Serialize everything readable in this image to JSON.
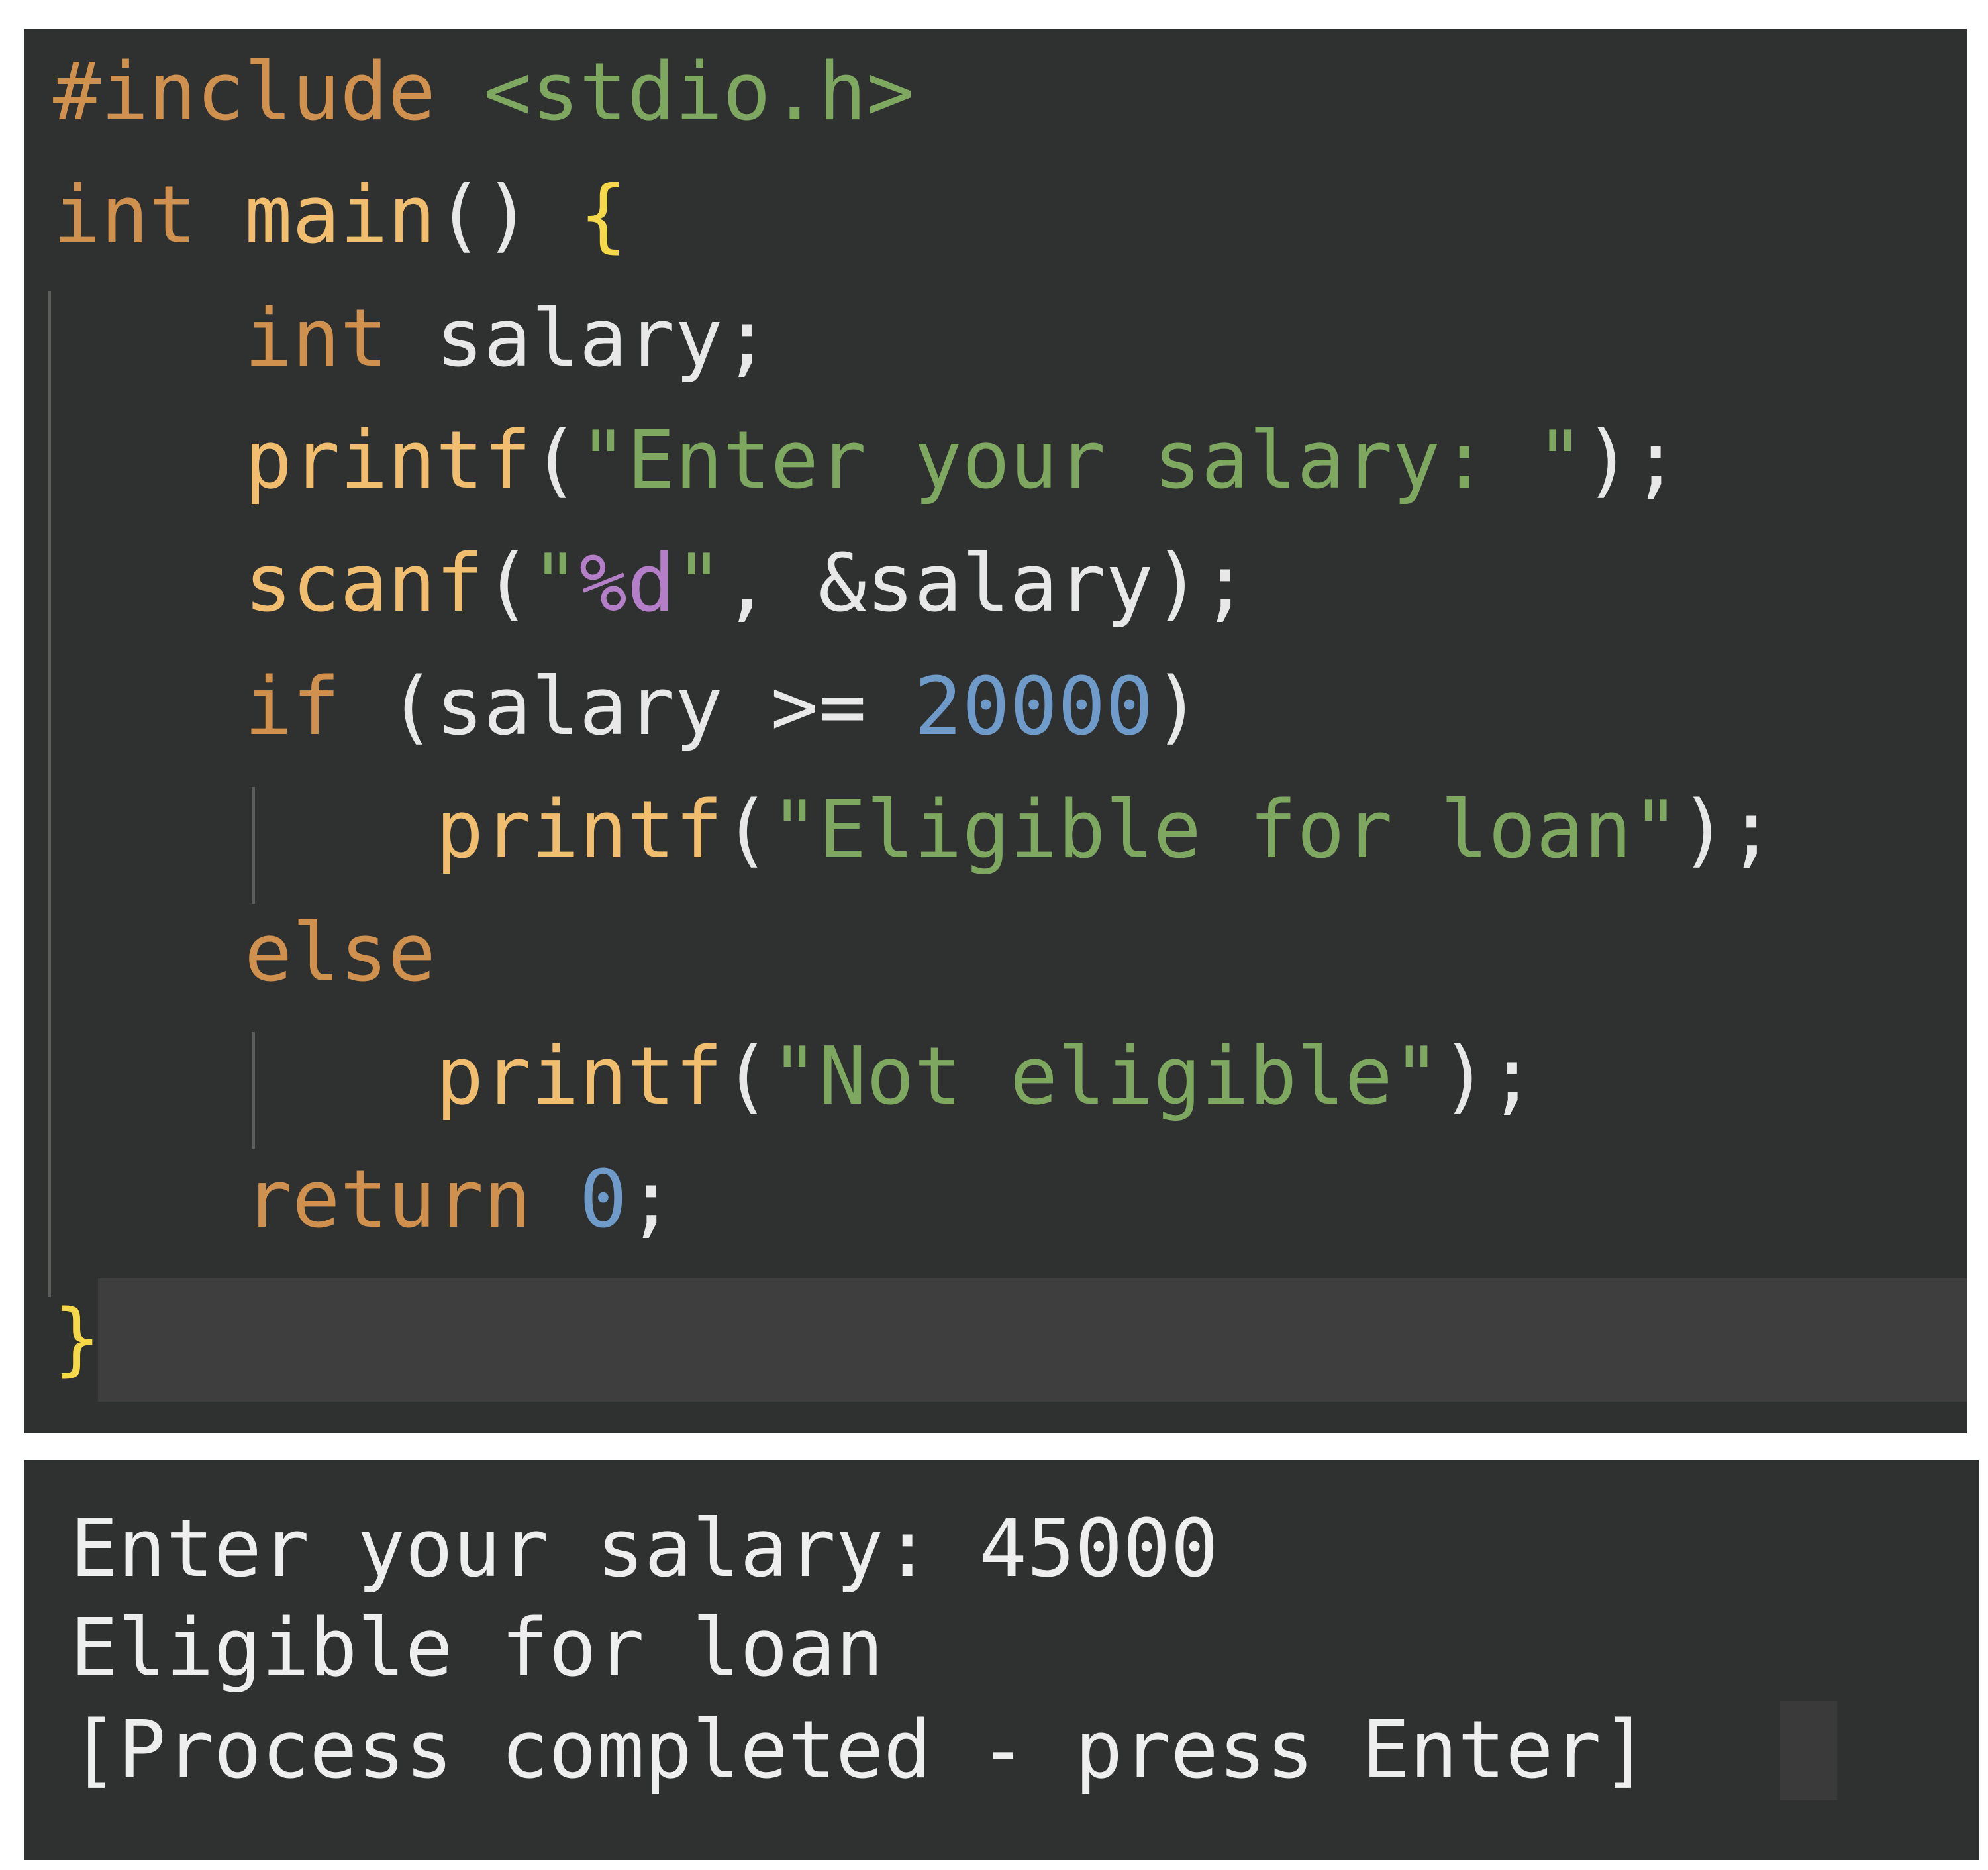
{
  "colors": {
    "keyword": "#d0914e",
    "function": "#f0be6e",
    "string": "#7ea860",
    "format_specifier": "#b57ec9",
    "number": "#6f9bcb",
    "brace": "#f5d94a",
    "plain": "#e8e8e8",
    "background": "#2f3130",
    "cursor_line": "#3e3e3e"
  },
  "editor": {
    "lines": [
      [
        {
          "t": "#include ",
          "c": "keyword"
        },
        {
          "t": "<stdio.h>",
          "c": "string"
        }
      ],
      [
        {
          "t": "int",
          "c": "keyword"
        },
        {
          "t": " ",
          "c": "plain"
        },
        {
          "t": "main",
          "c": "function"
        },
        {
          "t": "() ",
          "c": "plain"
        },
        {
          "t": "{",
          "c": "brace"
        }
      ],
      [
        {
          "t": "    ",
          "c": "plain"
        },
        {
          "t": "int",
          "c": "keyword"
        },
        {
          "t": " salary;",
          "c": "plain"
        }
      ],
      [
        {
          "t": "    ",
          "c": "plain"
        },
        {
          "t": "printf",
          "c": "function"
        },
        {
          "t": "(",
          "c": "plain"
        },
        {
          "t": "\"Enter your salary: \"",
          "c": "string"
        },
        {
          "t": ");",
          "c": "plain"
        }
      ],
      [
        {
          "t": "    ",
          "c": "plain"
        },
        {
          "t": "scanf",
          "c": "function"
        },
        {
          "t": "(",
          "c": "plain"
        },
        {
          "t": "\"",
          "c": "string"
        },
        {
          "t": "%d",
          "c": "format_specifier"
        },
        {
          "t": "\"",
          "c": "string"
        },
        {
          "t": ", &salary);",
          "c": "plain"
        }
      ],
      [
        {
          "t": "    ",
          "c": "plain"
        },
        {
          "t": "if",
          "c": "keyword"
        },
        {
          "t": " (salary >= ",
          "c": "plain"
        },
        {
          "t": "20000",
          "c": "number"
        },
        {
          "t": ")",
          "c": "plain"
        }
      ],
      [
        {
          "t": "        ",
          "c": "plain"
        },
        {
          "t": "printf",
          "c": "function"
        },
        {
          "t": "(",
          "c": "plain"
        },
        {
          "t": "\"Eligible for loan\"",
          "c": "string"
        },
        {
          "t": ");",
          "c": "plain"
        }
      ],
      [
        {
          "t": "    ",
          "c": "plain"
        },
        {
          "t": "else",
          "c": "keyword"
        }
      ],
      [
        {
          "t": "        ",
          "c": "plain"
        },
        {
          "t": "printf",
          "c": "function"
        },
        {
          "t": "(",
          "c": "plain"
        },
        {
          "t": "\"Not eligible\"",
          "c": "string"
        },
        {
          "t": ");",
          "c": "plain"
        }
      ],
      [
        {
          "t": "    ",
          "c": "plain"
        },
        {
          "t": "return",
          "c": "keyword"
        },
        {
          "t": " ",
          "c": "plain"
        },
        {
          "t": "0",
          "c": "number"
        },
        {
          "t": ";",
          "c": "plain"
        }
      ],
      [
        {
          "t": "}",
          "c": "brace"
        }
      ]
    ]
  },
  "terminal": {
    "lines": [
      "Enter your salary: 45000",
      "Eligible for loan",
      "[Process completed - press Enter]"
    ]
  }
}
